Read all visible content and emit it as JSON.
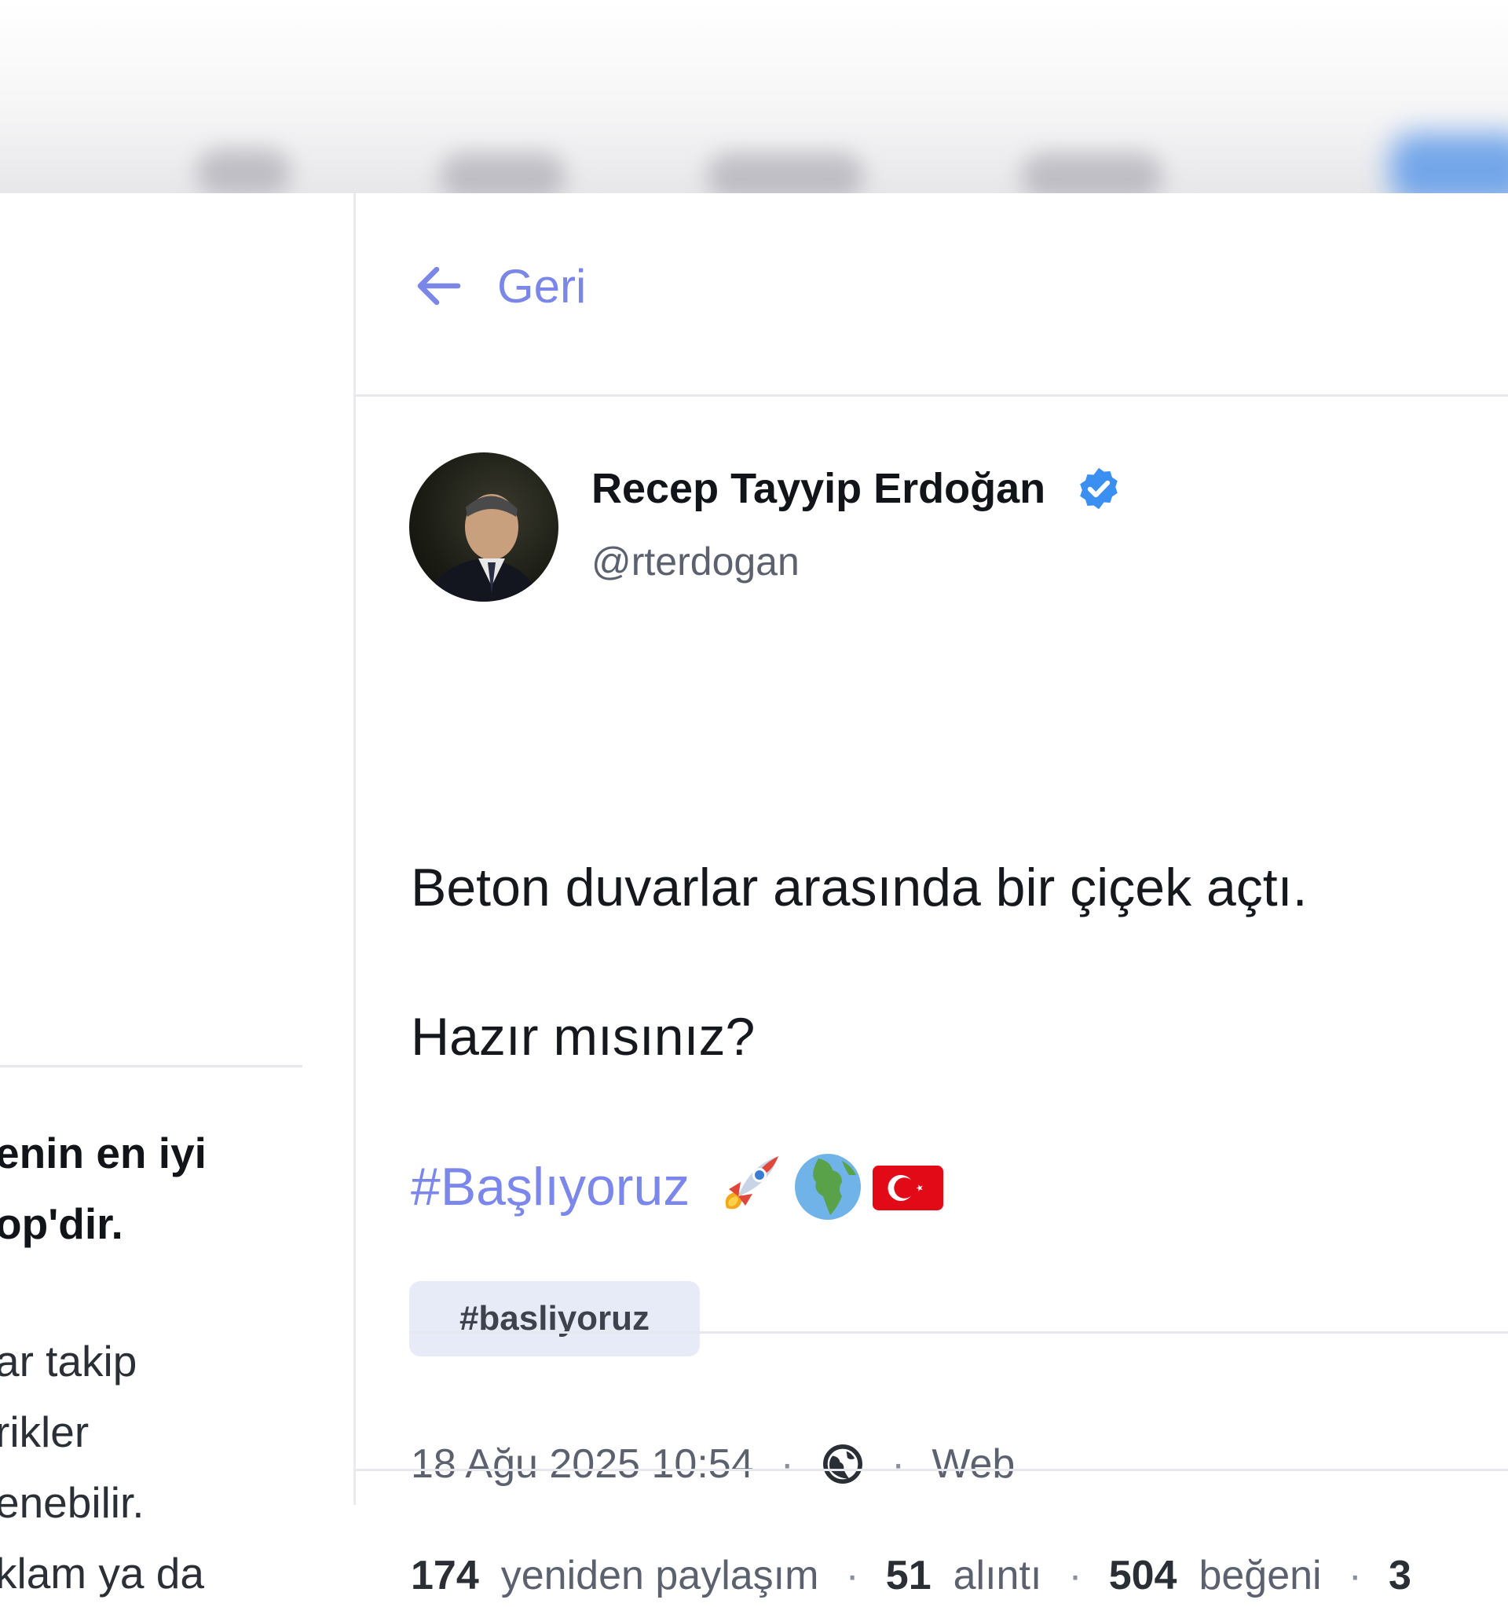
{
  "nav": {
    "back_label": "Geri"
  },
  "sidebar": {
    "lines": [
      "enin en iyi",
      "op'dir.",
      "ar takip",
      "rikler",
      "enebilir.",
      "klam ya da"
    ]
  },
  "tweet": {
    "author": {
      "display_name": "Recep Tayyip Erdoğan",
      "handle": "@rterdogan",
      "verified": true
    },
    "text_line_1": "Beton duvarlar arasında bir çiçek açtı.",
    "text_line_2": "Hazır mısınız?",
    "hashtag": "#Başlıyoruz",
    "emojis": [
      "rocket-emoji",
      "globe-africa-europe-emoji",
      "turkey-flag-emoji"
    ],
    "tag_chip": "#basliyoruz",
    "meta": {
      "timestamp": "18 Ağu 2025 10:54",
      "separator": "·",
      "source": "Web",
      "visibility_icon": "globe-icon"
    },
    "stats": {
      "reposts_count": "174",
      "reposts_label": "yeniden paylaşım",
      "quotes_count": "51",
      "quotes_label": "alıntı",
      "likes_count": "504",
      "likes_label": "beğeni",
      "separator": "·",
      "truncated_count": "3"
    }
  },
  "colors": {
    "accent": "#7b87ea",
    "chip_bg": "#e6ebf7",
    "verified_blue": "#3b8ff0",
    "divider": "#e6e8ee"
  }
}
